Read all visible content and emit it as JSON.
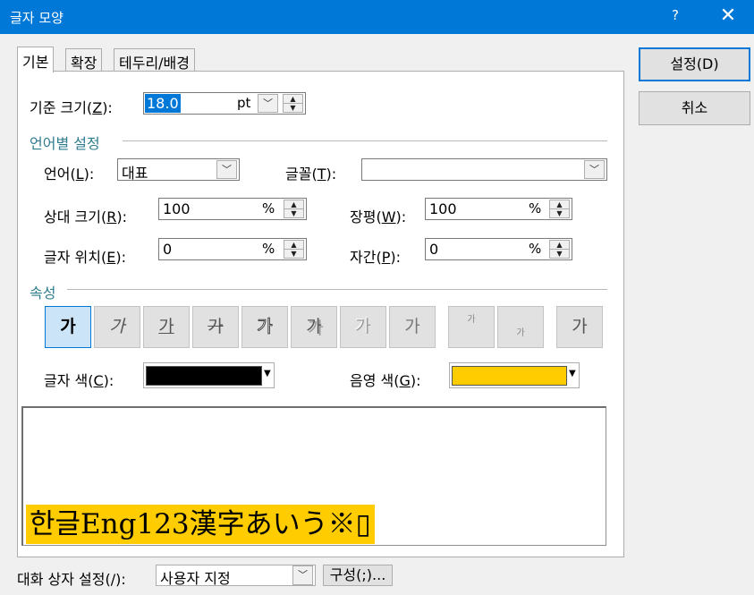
{
  "window": {
    "title": "글자 모양",
    "help": "?",
    "close": "✕"
  },
  "tabs": [
    {
      "label": "기본",
      "active": true
    },
    {
      "label": "확장",
      "active": false
    },
    {
      "label": "테두리/배경",
      "active": false
    }
  ],
  "base_size": {
    "label": "기준 크기",
    "mnemonic": "Z",
    "value": "18.0",
    "unit": "pt"
  },
  "lang_section": {
    "title": "언어별 설정",
    "language": {
      "label": "언어",
      "mnemonic": "L",
      "value": "대표"
    },
    "font": {
      "label": "글꼴",
      "mnemonic": "T",
      "value": ""
    },
    "relative_size": {
      "label": "상대 크기",
      "mnemonic": "R",
      "value": "100",
      "unit": "%"
    },
    "width_ratio": {
      "label": "장평",
      "mnemonic": "W",
      "value": "100",
      "unit": "%"
    },
    "position": {
      "label": "글자 위치",
      "mnemonic": "E",
      "value": "0",
      "unit": "%"
    },
    "spacing": {
      "label": "자간",
      "mnemonic": "P",
      "value": "0",
      "unit": "%"
    }
  },
  "attr_section": {
    "title": "속성",
    "buttons": [
      {
        "glyph": "가",
        "name": "bold-button"
      },
      {
        "glyph": "가",
        "name": "italic-button"
      },
      {
        "glyph": "가",
        "name": "underline-button"
      },
      {
        "glyph": "가",
        "name": "strikethrough-button"
      },
      {
        "glyph": "가",
        "name": "outline-button"
      },
      {
        "glyph": "가",
        "name": "shadow-button"
      },
      {
        "glyph": "가",
        "name": "emboss-button"
      },
      {
        "glyph": "가",
        "name": "engrave-button"
      },
      {
        "glyph": "가",
        "name": "superscript-button"
      },
      {
        "glyph": "가",
        "name": "subscript-button"
      },
      {
        "glyph": "가",
        "name": "normal-button"
      }
    ],
    "text_color": {
      "label": "글자 색",
      "mnemonic": "C",
      "color": "#000000"
    },
    "shade_color": {
      "label": "음영 색",
      "mnemonic": "G",
      "color": "#ffcc00"
    }
  },
  "preview": {
    "sample": "한글Eng123漢字あいう※▯"
  },
  "buttons": {
    "ok": "설정(D)",
    "cancel": "취소"
  },
  "footer": {
    "dialog_setting_label": "대화 상자 설정(/):",
    "dialog_setting_value": "사용자 지정",
    "config_label": "구성(;)..."
  }
}
